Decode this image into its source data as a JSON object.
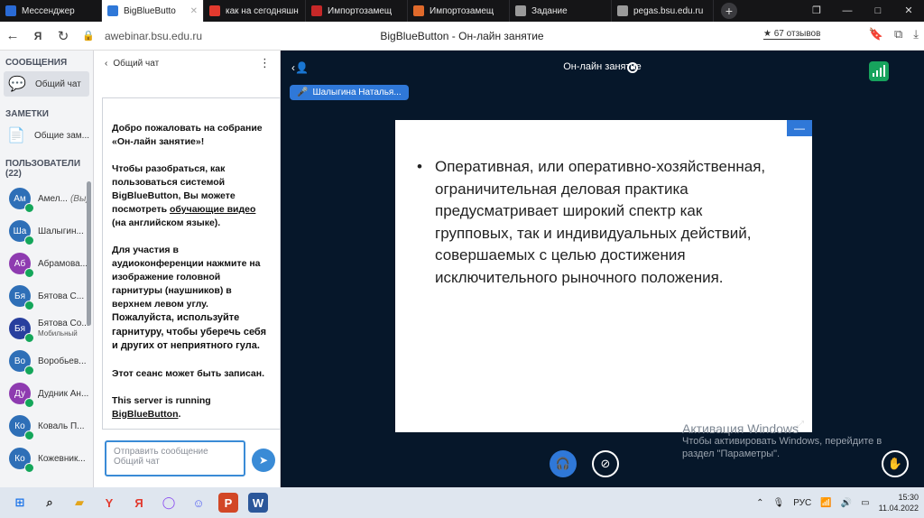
{
  "browser": {
    "tabs": [
      {
        "title": "Мессенджер",
        "icon": "messenger-icon",
        "color": "#2a6bd6",
        "active": false
      },
      {
        "title": "BigBlueButto",
        "icon": "bigbluebutton-icon",
        "color": "#2f78d8",
        "active": true
      },
      {
        "title": "как на сегодняшн",
        "icon": "yandex-icon",
        "color": "#e23a2e",
        "active": false
      },
      {
        "title": "Импортозамещ",
        "icon": "shield-icon",
        "color": "#c62828",
        "active": false
      },
      {
        "title": "Импортозамещ",
        "icon": "slash-icon",
        "color": "#e06a2b",
        "active": false
      },
      {
        "title": "Задание",
        "icon": "document-icon",
        "color": "#9a9a9a",
        "active": false
      },
      {
        "title": "pegas.bsu.edu.ru",
        "icon": "page-icon",
        "color": "#9a9a9a",
        "active": false
      }
    ],
    "new_tab": "+",
    "url": "awebinar.bsu.edu.ru",
    "page_title": "BigBlueButton - Он-лайн занятие",
    "reviews": "★ 67 отзывов"
  },
  "sidebar": {
    "messages_header": "СООБЩЕНИЯ",
    "public_chat": "Общий чат",
    "notes_header": "ЗАМЕТКИ",
    "shared_notes": "Общие зам...",
    "users_header": "ПОЛЬЗОВАТЕЛИ (22)",
    "users": [
      {
        "initials": "Ам",
        "name": "Амел...",
        "tag": "(Вы)",
        "sub": "",
        "color": "#2e6fb7"
      },
      {
        "initials": "Ша",
        "name": "Шалыгин...",
        "tag": "",
        "sub": "",
        "color": "#2e6fb7"
      },
      {
        "initials": "Аб",
        "name": "Абрамова...",
        "tag": "",
        "sub": "",
        "color": "#8e3bb0"
      },
      {
        "initials": "Бя",
        "name": "Бятова С...",
        "tag": "",
        "sub": "",
        "color": "#2e6fb7"
      },
      {
        "initials": "Бя",
        "name": "Бятова Со...",
        "tag": "",
        "sub": "Мобильный",
        "color": "#283f9e"
      },
      {
        "initials": "Во",
        "name": "Воробьев...",
        "tag": "",
        "sub": "",
        "color": "#2e6fb7"
      },
      {
        "initials": "Ду",
        "name": "Дудник Ан...",
        "tag": "",
        "sub": "",
        "color": "#8e3bb0"
      },
      {
        "initials": "Ко",
        "name": "Коваль П...",
        "tag": "",
        "sub": "",
        "color": "#2e6fb7"
      },
      {
        "initials": "Ко",
        "name": "Кожевник...",
        "tag": "",
        "sub": "",
        "color": "#2e6fb7"
      }
    ]
  },
  "chat": {
    "header": "Общий чат",
    "welcome_1": "Добро пожаловать на собрание «",
    "welcome_bold": "Он-лайн занятие",
    "welcome_2": "»!",
    "help_1": "Чтобы разобраться, как пользоваться системой BigBlueButton, Вы можете посмотреть ",
    "help_link": "обучающие видео",
    "help_2": " (на английском языке).",
    "audio_1": "Для участия в аудиоконференции нажмите на изображение головной гарнитуры (наушников) в верхнем левом углу.",
    "audio_bold": "Пожалуйста, используйте гарнитуру, чтобы уберечь себя и других от неприятного гула.",
    "recorded": "Этот сеанс может быть записан.",
    "server_1": "This server is running ",
    "server_link": "BigBlueButton",
    "server_2": ".",
    "placeholder": "Отправить сообщение Общий чат"
  },
  "session": {
    "title": "Он-лайн занятие",
    "talker": "Шалыгина Наталья...",
    "slide_text": "Оперативная, или оперативно-хозяйственная, ограничительная деловая практика предусматривает широкий спектр как групповых, так и индивидуальных действий, совершаемых с целью достижения исключительного рыночного положения."
  },
  "windows": {
    "activation_title": "Активация Windows",
    "activation_text": "Чтобы активировать Windows, перейдите в раздел \"Параметры\".",
    "lang": "РУС",
    "time": "15:30",
    "date": "11.04.2022"
  }
}
